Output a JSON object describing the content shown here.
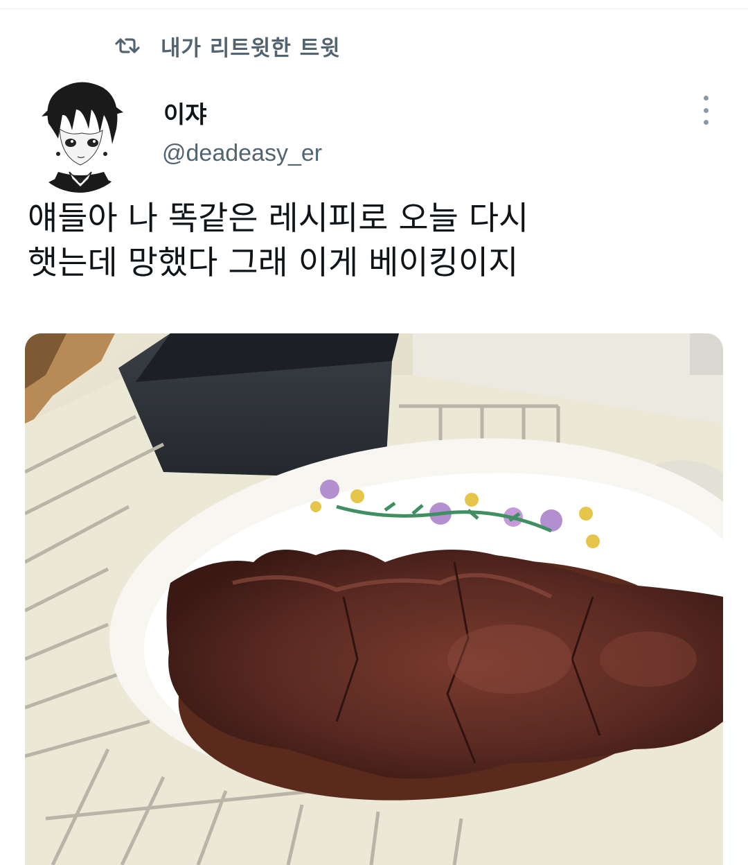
{
  "context": {
    "retweet_label": "내가 리트윗한 트윗",
    "icon": "retweet-icon"
  },
  "tweet": {
    "author": {
      "display_name": "이쟈",
      "handle": "@deadeasy_er",
      "avatar": "anime-boy-avatar"
    },
    "menu_icon": "more-vertical-icon",
    "text": "얘들아 나 똑같은 레시피로 오늘 다시\n햇는데 망했다 그래 이게 베이킹이지",
    "media": {
      "kind": "photo",
      "subject": "collapsed-chocolate-cake-photo"
    }
  },
  "colors": {
    "secondary_text": "#536471",
    "primary_text": "#0f1419",
    "divider": "#e6ecf0"
  }
}
